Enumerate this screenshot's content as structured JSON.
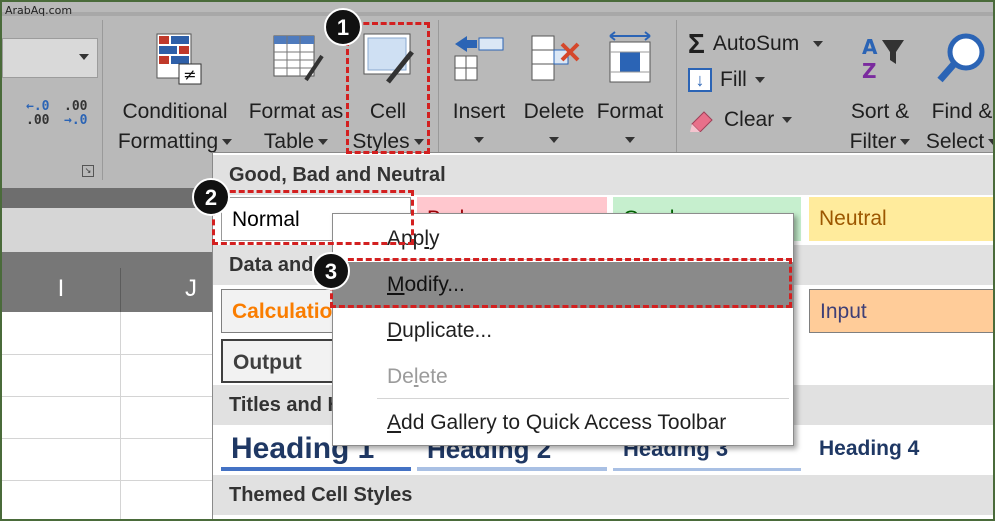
{
  "watermark": "ArabAq.com",
  "ribbon": {
    "decimal_increase": ".00",
    "decimal_increase_top": "←.0",
    "decimal_decrease_top": ".00",
    "decimal_decrease": "→.0",
    "conditional_formatting": {
      "line1": "Conditional",
      "line2": "Formatting"
    },
    "format_as_table": {
      "line1": "Format as",
      "line2": "Table"
    },
    "cell_styles": {
      "line1": "Cell",
      "line2": "Styles"
    },
    "insert": "Insert",
    "delete": "Delete",
    "format": "Format",
    "autosum": "AutoSum",
    "fill": "Fill",
    "clear": "Clear",
    "sort_filter": {
      "line1": "Sort &",
      "line2": "Filter"
    },
    "find_select": {
      "line1": "Find &",
      "line2": "Select"
    }
  },
  "callouts": {
    "one": "1",
    "two": "2",
    "three": "3"
  },
  "sheet": {
    "columns": [
      "I",
      "J"
    ]
  },
  "gallery": {
    "sections": {
      "good_bad_neutral": "Good, Bad and Neutral",
      "data_and_model": "Data and Model",
      "titles_and_headings": "Titles and Headings",
      "themed": "Themed Cell Styles"
    },
    "styles": {
      "normal": "Normal",
      "bad": "Bad",
      "good": "Good",
      "neutral": "Neutral",
      "calculation": "Calculation",
      "input": "Input",
      "output": "Output",
      "heading1": "Heading 1",
      "heading2": "Heading 2",
      "heading3": "Heading 3",
      "heading4": "Heading 4"
    },
    "colors": {
      "bad_fill": "#FFC7CE",
      "good_fill": "#C6EFCE",
      "neutral_fill": "#FFEB9C",
      "neutral_text": "#9C5700",
      "input_fill": "#FFCC99",
      "calculation_text": "#FA7D00",
      "heading_text": "#1F3864"
    }
  },
  "context_menu": {
    "apply": {
      "pre": "App",
      "key": "l",
      "post": "y"
    },
    "modify": {
      "pre": "",
      "key": "M",
      "post": "odify..."
    },
    "duplicate": {
      "pre": "",
      "key": "D",
      "post": "uplicate..."
    },
    "delete": {
      "pre": "De",
      "key": "l",
      "post": "ete"
    },
    "add_to_qat": {
      "pre": "",
      "key": "A",
      "post": "dd Gallery to Quick Access Toolbar"
    }
  }
}
